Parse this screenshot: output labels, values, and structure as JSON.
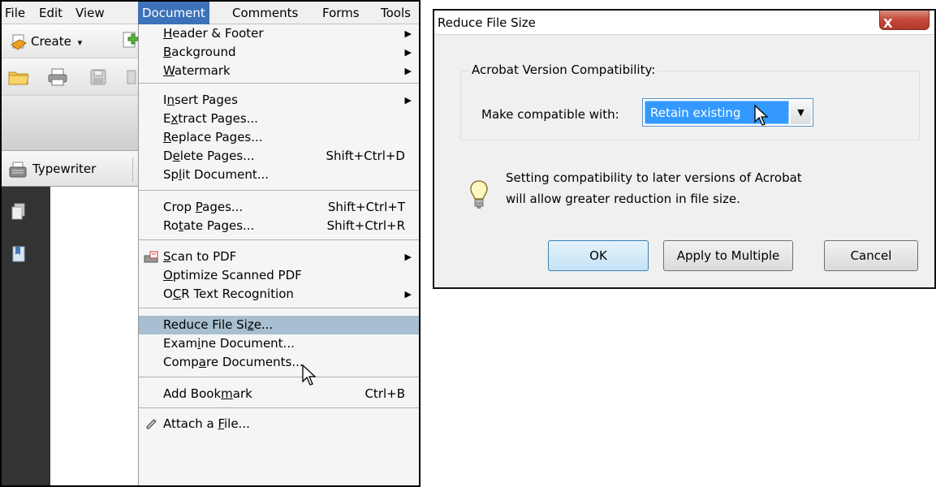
{
  "menubar": {
    "items": [
      "File",
      "Edit",
      "View",
      "Document",
      "Comments",
      "Forms",
      "Tools"
    ],
    "active": "Document"
  },
  "toolbar": {
    "create_label": "Create",
    "create_arrow": "▾",
    "typewriter_label": "Typewriter"
  },
  "document_menu": {
    "items": [
      {
        "pre": "",
        "u": "H",
        "post": "eader & Footer",
        "shortcut": "",
        "submenu": true
      },
      {
        "pre": "",
        "u": "B",
        "post": "ackground",
        "shortcut": "",
        "submenu": true
      },
      {
        "pre": "",
        "u": "W",
        "post": "atermark",
        "shortcut": "",
        "submenu": true
      },
      {
        "pre": "I",
        "u": "n",
        "post": "sert Pages",
        "shortcut": "",
        "submenu": true
      },
      {
        "pre": "E",
        "u": "x",
        "post": "tract Pages...",
        "shortcut": "",
        "submenu": false
      },
      {
        "pre": "",
        "u": "R",
        "post": "eplace Pages...",
        "shortcut": "",
        "submenu": false
      },
      {
        "pre": "D",
        "u": "e",
        "post": "lete Pages...",
        "shortcut": "Shift+Ctrl+D",
        "submenu": false
      },
      {
        "pre": "Sp",
        "u": "l",
        "post": "it Document...",
        "shortcut": "",
        "submenu": false
      },
      {
        "pre": "Crop ",
        "u": "P",
        "post": "ages...",
        "shortcut": "Shift+Ctrl+T",
        "submenu": false
      },
      {
        "pre": "Ro",
        "u": "t",
        "post": "ate Pages...",
        "shortcut": "Shift+Ctrl+R",
        "submenu": false
      },
      {
        "pre": "",
        "u": "S",
        "post": "can to PDF",
        "shortcut": "",
        "submenu": true
      },
      {
        "pre": "",
        "u": "O",
        "post": "ptimize Scanned PDF",
        "shortcut": "",
        "submenu": false
      },
      {
        "pre": "O",
        "u": "C",
        "post": "R Text Recognition",
        "shortcut": "",
        "submenu": true
      },
      {
        "pre": "Reduce File Si",
        "u": "z",
        "post": "e...",
        "shortcut": "",
        "submenu": false
      },
      {
        "pre": "Exam",
        "u": "i",
        "post": "ne Document...",
        "shortcut": "",
        "submenu": false
      },
      {
        "pre": "Comp",
        "u": "a",
        "post": "re Documents...",
        "shortcut": "",
        "submenu": false
      },
      {
        "pre": "Add Book",
        "u": "m",
        "post": "ark",
        "shortcut": "Ctrl+B",
        "submenu": false
      },
      {
        "pre": "Attach a ",
        "u": "F",
        "post": "ile...",
        "shortcut": "",
        "submenu": false
      }
    ],
    "submenu_arrow": "▶"
  },
  "dialog": {
    "title": "Reduce File Size",
    "close_glyph": "X",
    "group_label": "Acrobat Version Compatibility:",
    "compat_label": "Make compatible with:",
    "compat_value": "Retain existing",
    "dropdown_arrow": "▼",
    "info_line1": "Setting compatibility to later versions of Acrobat",
    "info_line2": "will allow greater reduction in file size.",
    "ok_label": "OK",
    "apply_label": "Apply to Multiple",
    "cancel_label": "Cancel"
  },
  "colors": {
    "menu_highlight": "#3d72b8",
    "item_highlight": "#a7bfd0",
    "selection_blue": "#3399ff",
    "close_red": "#c4483a"
  }
}
